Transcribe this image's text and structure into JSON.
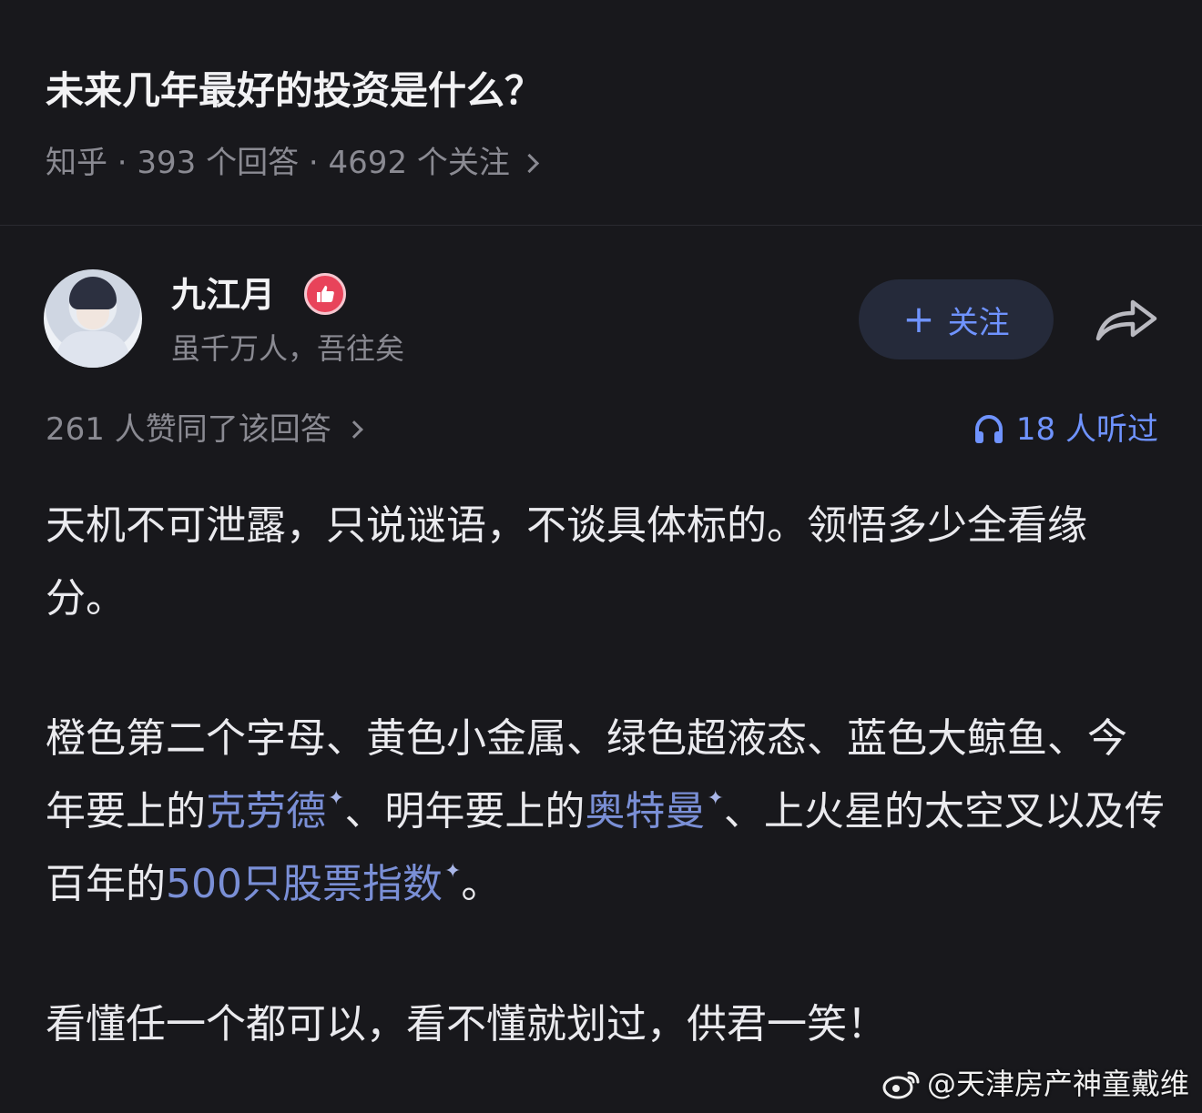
{
  "question": {
    "title": "未来几年最好的投资是什么？",
    "meta": "知乎 · 393 个回答 · 4692 个关注"
  },
  "author": {
    "name": "九江月",
    "bio": "虽千万人，吾往矣",
    "follow_label": "关注"
  },
  "stats": {
    "upvote_text": "261 人赞同了该回答",
    "listen_text": "18 人听过"
  },
  "content": {
    "p1": "天机不可泄露，只说谜语，不谈具体标的。领悟多少全看缘分。",
    "p2_a": "橙色第二个字母、黄色小金属、绿色超液态、蓝色大鲸鱼、今年要上的",
    "p2_link1": "克劳德",
    "p2_b": "、明年要上的",
    "p2_link2": "奥特曼",
    "p2_c": "、上火星的太空叉以及传百年的",
    "p2_link3": "500只股票指数",
    "p2_d": "。",
    "p3": "看懂任一个都可以，看不懂就划过，供君一笑！",
    "link_mark": "✦"
  },
  "watermark": {
    "text": "@天津房产神童戴维"
  },
  "colors": {
    "background": "#18181c",
    "accent": "#6f93ff",
    "link": "#7a8fd6",
    "muted": "#8a8a92"
  },
  "icons": {
    "share": "share-arrow-icon",
    "listen": "headphones-icon",
    "badge": "thumbs-up-badge-icon",
    "watermark": "weibo-logo-icon"
  }
}
